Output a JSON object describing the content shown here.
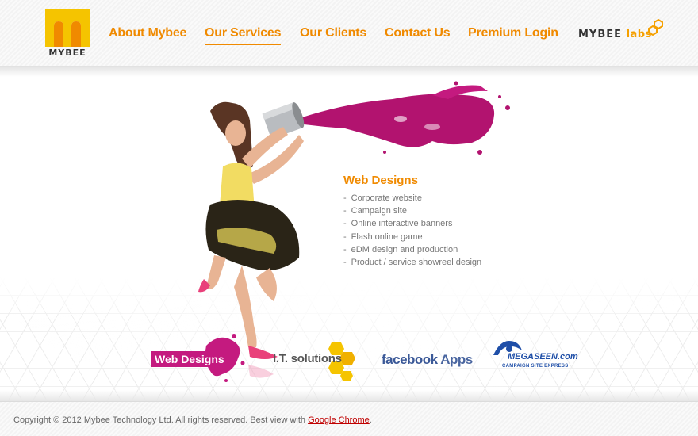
{
  "brand": {
    "name": "MYBEE",
    "logo_icon": "mybee-m-logo",
    "colors": {
      "orange": "#f08a00",
      "yellow": "#f5c400",
      "magenta": "#c41a7f"
    }
  },
  "nav": {
    "items": [
      {
        "label": "About Mybee",
        "active": false
      },
      {
        "label": "Our Services",
        "active": true
      },
      {
        "label": "Our Clients",
        "active": false
      },
      {
        "label": "Contact Us",
        "active": false
      },
      {
        "label": "Premium Login",
        "active": false
      }
    ],
    "labs_logo": {
      "brand": "MYBEE",
      "suffix": "labs"
    }
  },
  "hero": {
    "image": "woman-splashing-paint",
    "section_title": "Web Designs",
    "services": [
      "Corporate website",
      "Campaign site",
      "Online interactive banners",
      "Flash online game",
      "eDM design and production",
      "Product / service showreel design"
    ]
  },
  "categories": {
    "web_designs": "Web Designs",
    "it_solutions": "I.T. solutions",
    "facebook_apps": {
      "brand": "facebook",
      "suffix": "Apps"
    },
    "megaseen": {
      "name": "MEGASEEN.com",
      "tagline": "CAMPAIGN SITE EXPRESS"
    }
  },
  "footer": {
    "copyright": "Copyright © 2012 Mybee Technology Ltd. All rights reserved. Best view with ",
    "link_label": "Google Chrome",
    "end": "."
  }
}
